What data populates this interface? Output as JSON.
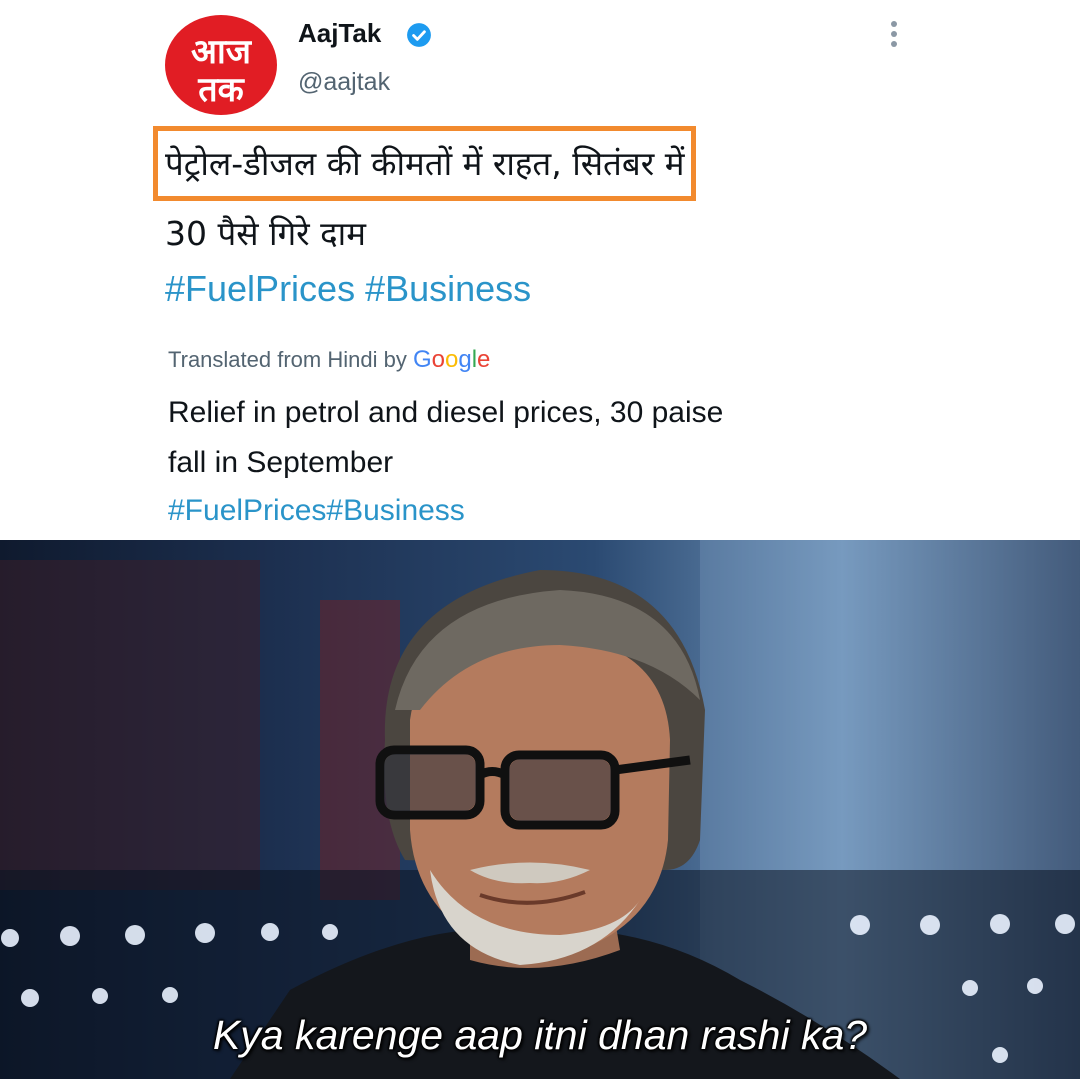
{
  "tweet": {
    "avatar_logo": [
      "आज",
      "तक"
    ],
    "account_name": "AajTak",
    "handle": "@aajtak",
    "text_hindi_highlighted": "पेट्रोल-डीजल की कीमतों में राहत,",
    "text_hindi_rest": " सितंबर में",
    "text_hindi_line2": "30 पैसे गिरे दाम",
    "hashtags": "#FuelPrices #Business",
    "translated_label": "Translated from Hindi by ",
    "google_label": [
      "G",
      "o",
      "o",
      "g",
      "l",
      "e"
    ],
    "translation_line1": "Relief in petrol and diesel prices, 30 paise",
    "translation_line2": "fall in September",
    "translation_hashtags": "#FuelPrices#Business"
  },
  "meme": {
    "caption": "Kya karenge aap itni dhan rashi ka?"
  },
  "colors": {
    "highlight": "#f28a2e",
    "hashtag": "#2a94c9",
    "avatar_bg": "#e11d24",
    "verified": "#1d9bf0"
  }
}
